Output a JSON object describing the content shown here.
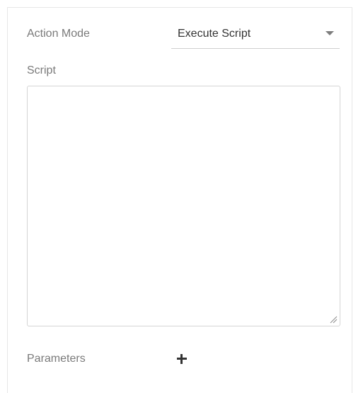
{
  "action_mode": {
    "label": "Action Mode",
    "selected_value": "Execute Script",
    "icon": "chevron-down-icon"
  },
  "script": {
    "label": "Script",
    "value": "",
    "resize_icon": "resize-grip-icon"
  },
  "parameters": {
    "label": "Parameters",
    "add_icon": "plus-icon"
  },
  "colors": {
    "label_text": "#7a7a7a",
    "value_text": "#333333",
    "border": "#d4d4d4"
  }
}
